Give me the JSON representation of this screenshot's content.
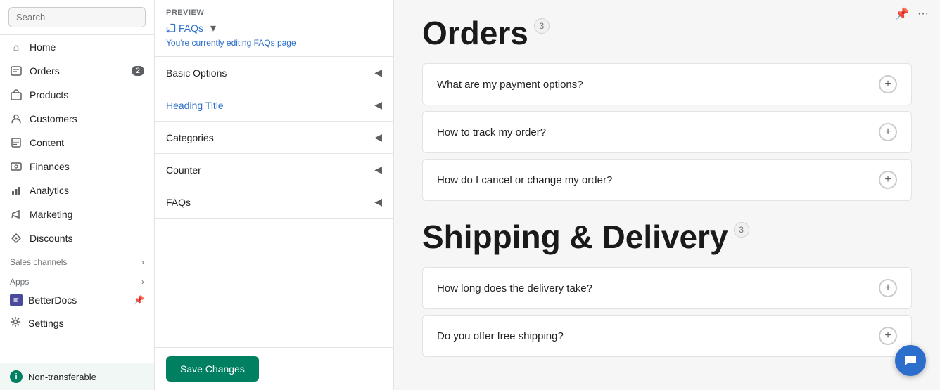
{
  "sidebar": {
    "search_placeholder": "Search",
    "items": [
      {
        "label": "Home",
        "icon": "home-icon",
        "badge": null
      },
      {
        "label": "Orders",
        "icon": "orders-icon",
        "badge": "2"
      },
      {
        "label": "Products",
        "icon": "products-icon",
        "badge": null
      },
      {
        "label": "Customers",
        "icon": "customers-icon",
        "badge": null
      },
      {
        "label": "Content",
        "icon": "content-icon",
        "badge": null
      },
      {
        "label": "Finances",
        "icon": "finances-icon",
        "badge": null
      },
      {
        "label": "Analytics",
        "icon": "analytics-icon",
        "badge": null
      },
      {
        "label": "Marketing",
        "icon": "marketing-icon",
        "badge": null
      },
      {
        "label": "Discounts",
        "icon": "discounts-icon",
        "badge": null
      }
    ],
    "sales_channels_label": "Sales channels",
    "apps_label": "Apps",
    "betterdocs_label": "BetterDocs",
    "settings_label": "Settings",
    "bottom_label": "Non-transferable"
  },
  "middle": {
    "preview_label": "PREVIEW",
    "faqs_link": "FAQs",
    "editing_text": "You're currently editing",
    "editing_page": "FAQs page",
    "sections": [
      {
        "label": "Basic Options",
        "active": false
      },
      {
        "label": "Heading Title",
        "active": true
      },
      {
        "label": "Categories",
        "active": false
      },
      {
        "label": "Counter",
        "active": false
      },
      {
        "label": "FAQs",
        "active": false
      }
    ],
    "save_btn": "Save Changes"
  },
  "preview": {
    "orders_title": "Orders",
    "orders_count": "3",
    "shipping_title": "Shipping & Delivery",
    "shipping_count": "3",
    "faq_items_orders": [
      {
        "text": "What are my payment options?"
      },
      {
        "text": "How to track my order?"
      },
      {
        "text": "How do I cancel or change my order?"
      }
    ],
    "faq_items_shipping": [
      {
        "text": "How long does the delivery take?"
      },
      {
        "text": "Do you offer free shipping?"
      }
    ]
  },
  "icons": {
    "home": "⌂",
    "orders": "◫",
    "products": "◻",
    "customers": "👤",
    "content": "▤",
    "finances": "💲",
    "analytics": "📊",
    "marketing": "📢",
    "discounts": "🏷",
    "settings": "⚙",
    "pin": "📌",
    "chat": "💬",
    "plus": "+"
  }
}
